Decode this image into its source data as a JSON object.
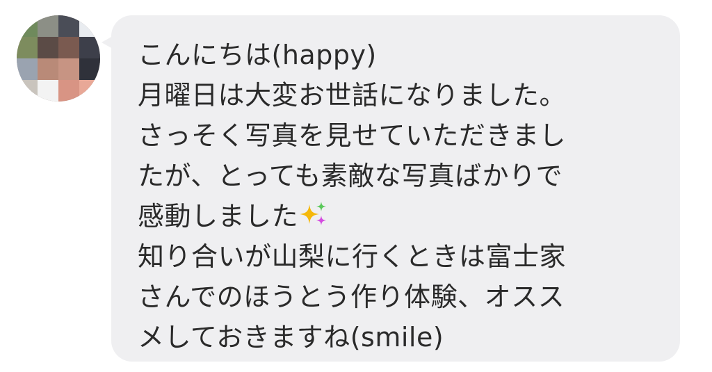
{
  "message": {
    "lines": [
      "こんにちは(happy)",
      "月曜日は大変お世話になりました。",
      "さっそく写真を見せていただきまし",
      "たが、とっても素敵な写真ばかりで",
      "感動しました",
      "知り合いが山梨に行くときは富士家",
      "さんでのほうとう作り体験、オスス",
      "メしておきますね(smile)"
    ],
    "sparkle_icon": "sparkles-icon"
  },
  "avatar": {
    "pixelated": true
  },
  "colors": {
    "bubble_background": "#efeff1",
    "text": "#2a2a2a",
    "page_background": "#ffffff"
  }
}
